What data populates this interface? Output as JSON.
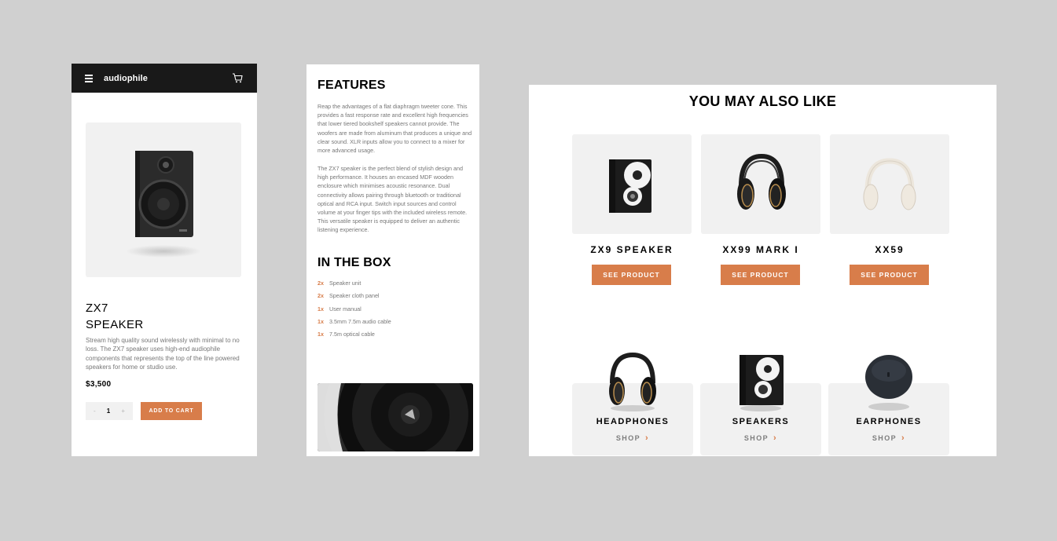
{
  "mobile": {
    "logo": "audiophile",
    "product_name_line1": "ZX7",
    "product_name_line2": "SPEAKER",
    "description": "Stream high quality sound wirelessly with minimal to no loss. The ZX7 speaker uses high-end audiophile components that represents the top of the line powered speakers for home or studio use.",
    "price": "$3,500",
    "quantity": "1",
    "minus_label": "-",
    "plus_label": "+",
    "add_to_cart_label": "ADD TO CART",
    "icons": [
      "hamburger-menu-icon",
      "cart-icon"
    ]
  },
  "features": {
    "title": "FEATURES",
    "paragraph1": "Reap the advantages of a flat diaphragm tweeter cone. This provides a fast response rate and excellent high frequencies that lower tiered bookshelf speakers cannot provide. The woofers are made from aluminum that produces a unique and clear sound. XLR inputs allow you to connect to a mixer for more advanced usage.",
    "paragraph2": "The ZX7 speaker is the perfect blend of stylish design and high performance. It houses an encased MDF wooden enclosure which minimises acoustic resonance. Dual connectivity allows pairing through bluetooth or traditional optical and RCA input. Switch input sources and control volume at your finger tips with the included wireless remote. This versatile speaker is equipped to deliver an authentic listening experience.",
    "in_the_box_title": "IN THE BOX",
    "box_items": [
      {
        "qty": "2x",
        "item": "Speaker unit"
      },
      {
        "qty": "2x",
        "item": "Speaker cloth panel"
      },
      {
        "qty": "1x",
        "item": "User manual"
      },
      {
        "qty": "1x",
        "item": "3.5mm 7.5m audio cable"
      },
      {
        "qty": "1x",
        "item": "7.5m optical cable"
      }
    ]
  },
  "also_like": {
    "title": "YOU MAY ALSO LIKE",
    "products": [
      {
        "name": "ZX9 SPEAKER",
        "button": "SEE PRODUCT"
      },
      {
        "name": "XX99 MARK I",
        "button": "SEE PRODUCT"
      },
      {
        "name": "XX59",
        "button": "SEE PRODUCT"
      }
    ],
    "categories": [
      {
        "name": "HEADPHONES",
        "link": "SHOP"
      },
      {
        "name": "SPEAKERS",
        "link": "SHOP"
      },
      {
        "name": "EARPHONES",
        "link": "SHOP"
      }
    ]
  },
  "colors": {
    "accent": "#d87d4a",
    "dark": "#191919",
    "light_gray": "#f1f1f1",
    "background": "#d0d0d0"
  }
}
